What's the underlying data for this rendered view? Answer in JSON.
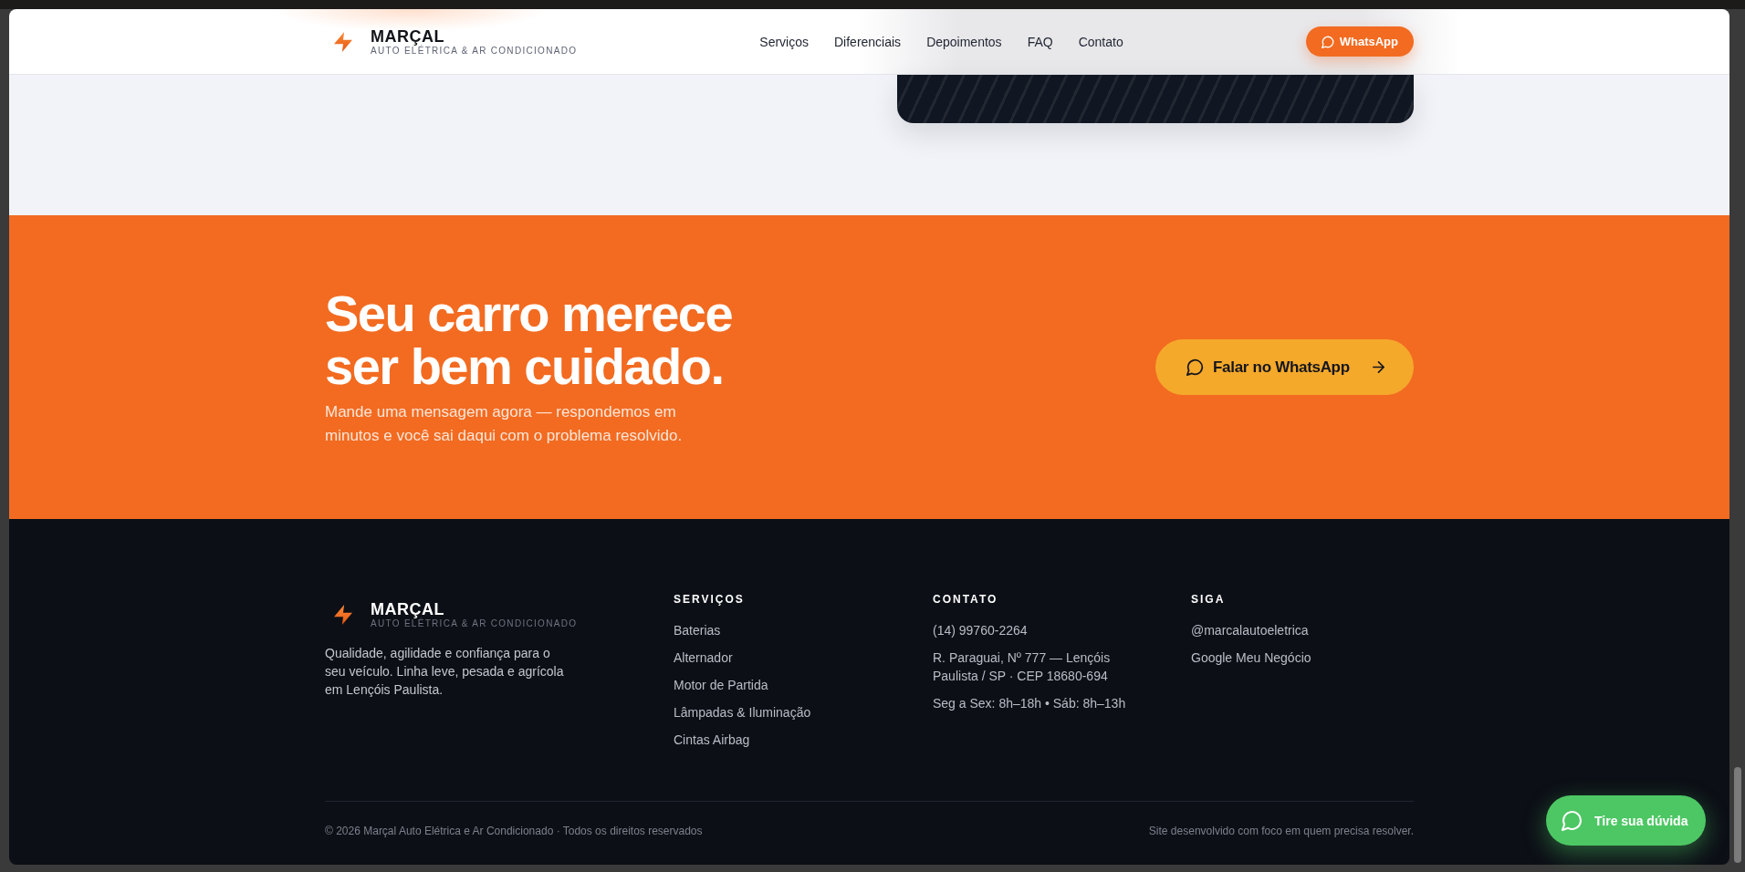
{
  "header": {
    "brand": {
      "name": "MARÇAL",
      "tagline": "AUTO ELÉTRICA & AR CONDICIONADO"
    },
    "nav": [
      {
        "label": "Serviços"
      },
      {
        "label": "Diferenciais"
      },
      {
        "label": "Depoimentos"
      },
      {
        "label": "FAQ"
      },
      {
        "label": "Contato"
      }
    ],
    "button": {
      "label": "WhatsApp"
    }
  },
  "cta": {
    "heading": "Seu carro merece ser bem cuidado.",
    "text": "Mande uma mensagem agora — respondemos em minutos e você sai daqui com o problema resolvido.",
    "button": {
      "label": "Falar no WhatsApp"
    }
  },
  "footer": {
    "brand": {
      "name": "MARÇAL",
      "tagline": "AUTO ELÉTRICA & AR CONDICIONADO"
    },
    "description": "Qualidade, agilidade e confiança para o seu veículo. Linha leve, pesada e agrícola em Lençóis Paulista.",
    "columns": [
      {
        "title": "SERVIÇOS",
        "items": [
          "Baterias",
          "Alternador",
          "Motor de Partida",
          "Lâmpadas & Iluminação",
          "Cintas Airbag"
        ]
      },
      {
        "title": "CONTATO",
        "items": [
          "(14) 99760-2264",
          "R. Paraguai, Nº 777 — Lençóis Paulista / SP · CEP 18680-694",
          "Seg a Sex: 8h–18h • Sáb: 8h–13h"
        ]
      },
      {
        "title": "SIGA",
        "items": [
          "@marcalautoeletrica",
          "Google Meu Negócio"
        ]
      }
    ],
    "copyright": "© 2026 Marçal Auto Elétrica e Ar Condicionado · Todos os direitos reservados",
    "credit": "Site desenvolvido com foco em quem precisa resolver."
  },
  "chat_button": {
    "label": "Tire sua dúvida"
  }
}
